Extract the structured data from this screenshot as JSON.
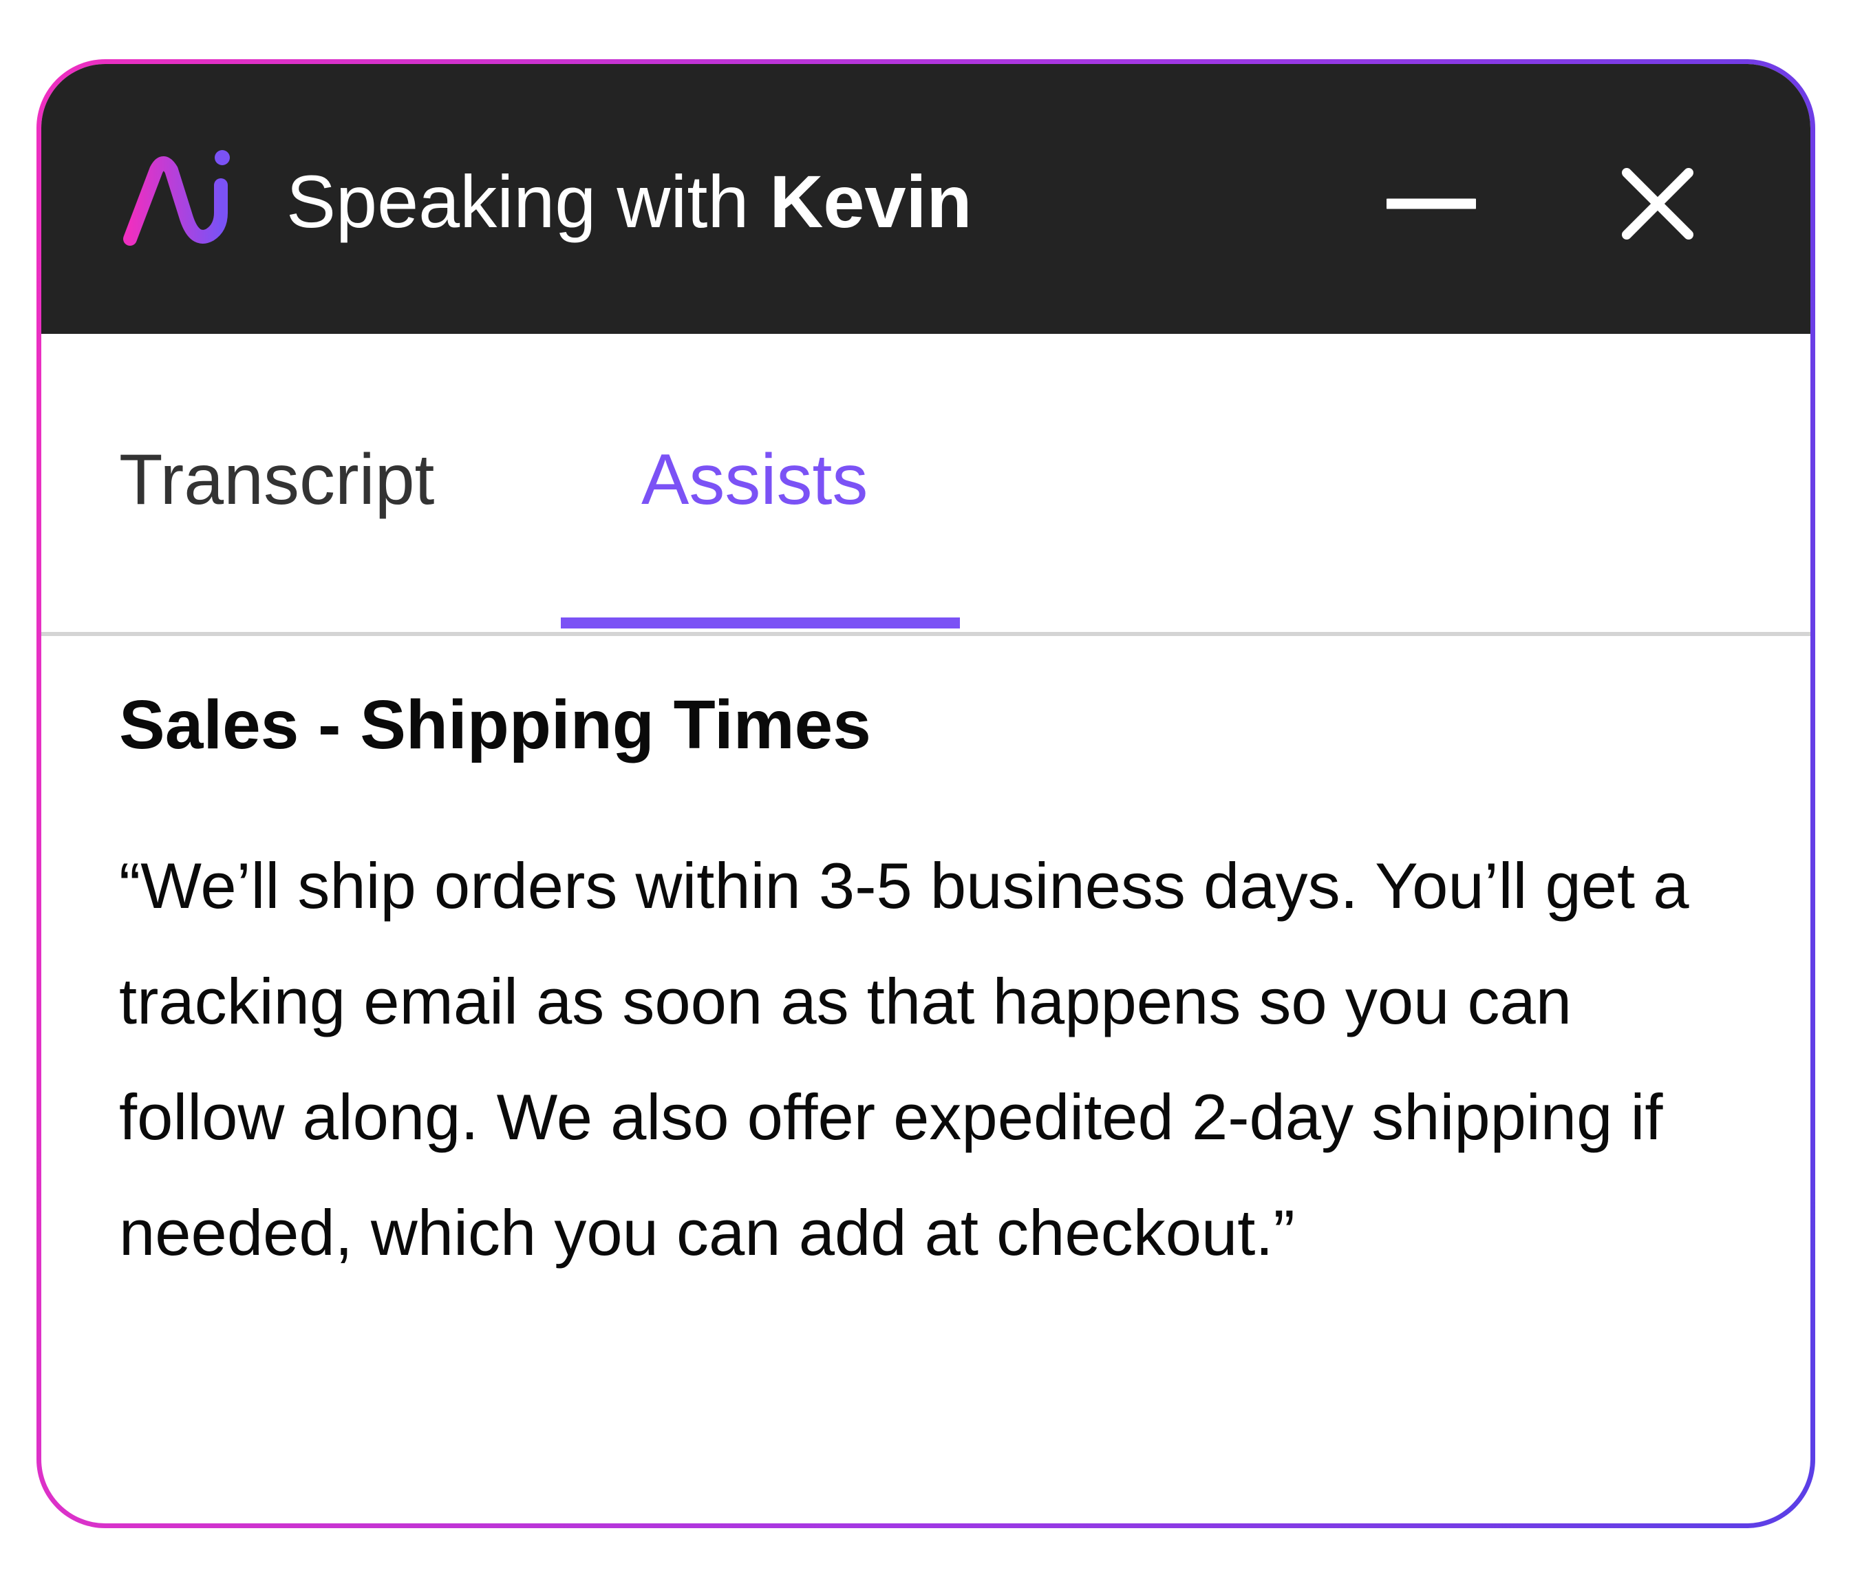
{
  "window": {
    "title_prefix": "Speaking with ",
    "title_name": "Kevin"
  },
  "controls": {
    "minimize_icon": "minimize-icon",
    "close_icon": "close-icon"
  },
  "tabs": [
    {
      "label": "Transcript",
      "active": false
    },
    {
      "label": "Assists",
      "active": true
    }
  ],
  "assist": {
    "heading": "Sales - Shipping Times",
    "text": "“We’ll ship orders within 3-5 business days. You’ll get a tracking email as soon as that happens so you can follow along. We also offer expedited 2-day shipping if needed, which you can add at checkout.”"
  },
  "colors": {
    "accent": "#7b52f5",
    "titlebar": "#232323",
    "border_gradient_start": "#ee2fc0",
    "border_gradient_end": "#5a3fe6"
  }
}
